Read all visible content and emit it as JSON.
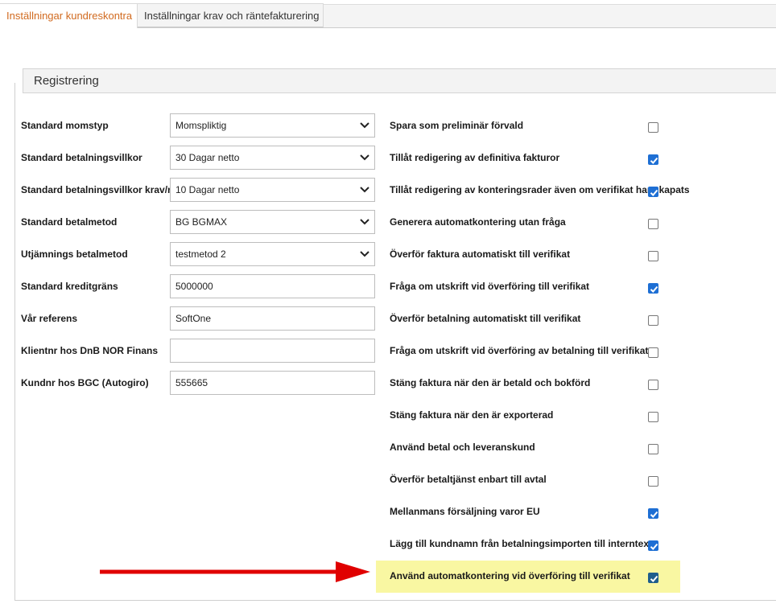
{
  "tabs": [
    {
      "label": "Inställningar kundreskontra",
      "active": true
    },
    {
      "label": "Inställningar krav och räntefakturering",
      "active": false
    }
  ],
  "section": {
    "title": "Registrering"
  },
  "fields": {
    "momstyp": {
      "label": "Standard momstyp",
      "value": "Momspliktig"
    },
    "betalningsvillkor": {
      "label": "Standard betalningsvillkor",
      "value": "30 Dagar netto"
    },
    "betalningsvillkor_krav": {
      "label": "Standard betalningsvillkor krav/ränta",
      "value": "10 Dagar netto"
    },
    "betalmetod": {
      "label": "Standard betalmetod",
      "value": "BG BGMAX"
    },
    "utjamning": {
      "label": "Utjämnings betalmetod",
      "value": "testmetod 2"
    },
    "kreditgrans": {
      "label": "Standard kreditgräns",
      "value": "5000000"
    },
    "referens": {
      "label": "Vår referens",
      "value": "SoftOne"
    },
    "dnb": {
      "label": "Klientnr hos DnB NOR Finans",
      "value": ""
    },
    "bgc": {
      "label": "Kundnr hos BGC (Autogiro)",
      "value": "555665"
    }
  },
  "checkboxes": [
    {
      "label": "Spara som preliminär förvald",
      "checked": false
    },
    {
      "label": "Tillåt redigering av definitiva fakturor",
      "checked": true
    },
    {
      "label": "Tillåt redigering av konteringsrader även om verifikat har skapats",
      "checked": true
    },
    {
      "label": "Generera automatkontering utan fråga",
      "checked": false
    },
    {
      "label": "Överför faktura automatiskt till verifikat",
      "checked": false
    },
    {
      "label": "Fråga om utskrift vid överföring till verifikat",
      "checked": true
    },
    {
      "label": "Överför betalning automatiskt till verifikat",
      "checked": false
    },
    {
      "label": "Fråga om utskrift vid överföring av betalning till verifikat",
      "checked": false
    },
    {
      "label": "Stäng faktura när den är betald och bokförd",
      "checked": false
    },
    {
      "label": "Stäng faktura när den är exporterad",
      "checked": false
    },
    {
      "label": "Använd betal och leveranskund",
      "checked": false
    },
    {
      "label": "Överför betaltjänst enbart till avtal",
      "checked": false
    },
    {
      "label": "Mellanmans försäljning varor EU",
      "checked": true
    },
    {
      "label": "Lägg till kundnamn från betalningsimporten till interntext",
      "checked": true
    },
    {
      "label": "Använd automatkontering vid överföring till verifikat",
      "checked": true
    }
  ],
  "colors": {
    "active_tab": "#d16a1f",
    "checkbox": "#1e6fd4",
    "highlight": "#f9f7a2",
    "arrow": "#e00000"
  },
  "icons": {
    "dropdown": "chevron-down-icon",
    "checkmark": "checkmark-icon",
    "annotation": "red-arrow-icon"
  }
}
